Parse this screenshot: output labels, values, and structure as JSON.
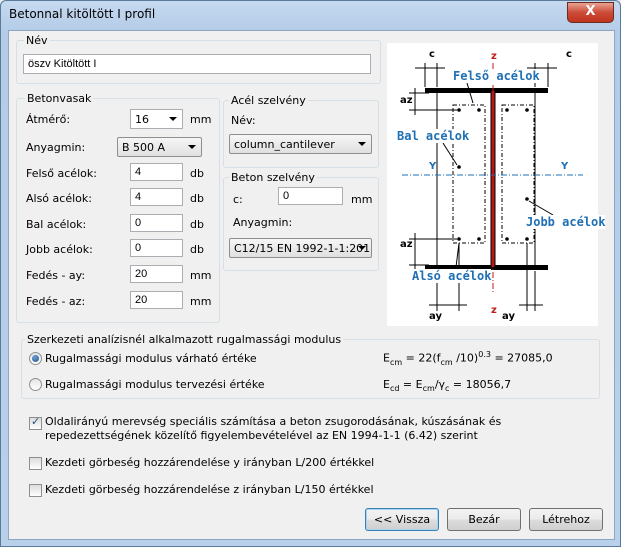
{
  "window": {
    "title": "Betonnal kitöltött I profil",
    "close_label": "X"
  },
  "name_group": {
    "label": "Név",
    "value": "öszv Kitöltött I"
  },
  "rebar_group": {
    "label": "Betonvasak",
    "diameter": {
      "label": "Átmérő:",
      "value": "16",
      "unit": "mm"
    },
    "material": {
      "label": "Anyagmin:",
      "value": "B 500 A"
    },
    "top": {
      "label": "Felső acélok:",
      "value": "4",
      "unit": "db"
    },
    "bottom": {
      "label": "Alsó acélok:",
      "value": "4",
      "unit": "db"
    },
    "left": {
      "label": "Bal acélok:",
      "value": "0",
      "unit": "db"
    },
    "right": {
      "label": "Jobb acélok:",
      "value": "0",
      "unit": "db"
    },
    "cover_ay": {
      "label": "Fedés - ay:",
      "value": "20",
      "unit": "mm"
    },
    "cover_az": {
      "label": "Fedés - az:",
      "value": "20",
      "unit": "mm"
    }
  },
  "steel_group": {
    "label": "Acél szelvény",
    "name_label": "Név:",
    "name_value": "column_cantilever"
  },
  "concrete_group": {
    "label": "Beton szelvény",
    "c_label": "c:",
    "c_value": "0",
    "c_unit": "mm",
    "material_label": "Anyagmin:",
    "material_value": "C12/15 EN 1992-1-1:201"
  },
  "diagram": {
    "top_label": "Felső acélok",
    "bottom_label": "Alsó acélok",
    "left_label": "Bal acélok",
    "right_label": "Jobb acélok",
    "c": "c",
    "z": "z",
    "y": "Y",
    "az": "az",
    "ay": "ay"
  },
  "modulus_group": {
    "label": "Szerkezeti analízisnél alkalmazott rugalmassági modulus",
    "option1": {
      "label": "Rugalmassági modulus várható értéke",
      "formula": "Ecm = 22(fcm /10)^0.3 = 27085,0",
      "selected": true
    },
    "option2": {
      "label": "Rugalmassági modulus tervezési értéke",
      "formula": "Ecd = Ecm/γc = 18056,7",
      "selected": false
    }
  },
  "checks": [
    {
      "label": "Oldalirányú merevség speciális számítása a beton zsugorodásának, kúszásának és repedezettségének közelítő figyelembevételével az EN 1994-1-1 (6.42) szerint",
      "checked": true
    },
    {
      "label": "Kezdeti görbeség hozzárendelése y irányban L/200 értékkel",
      "checked": false
    },
    {
      "label": "Kezdeti görbeség hozzárendelése z irányban L/150 értékkel",
      "checked": false
    }
  ],
  "buttons": {
    "back": "<< Vissza",
    "close": "Bezár",
    "create": "Létrehoz"
  }
}
